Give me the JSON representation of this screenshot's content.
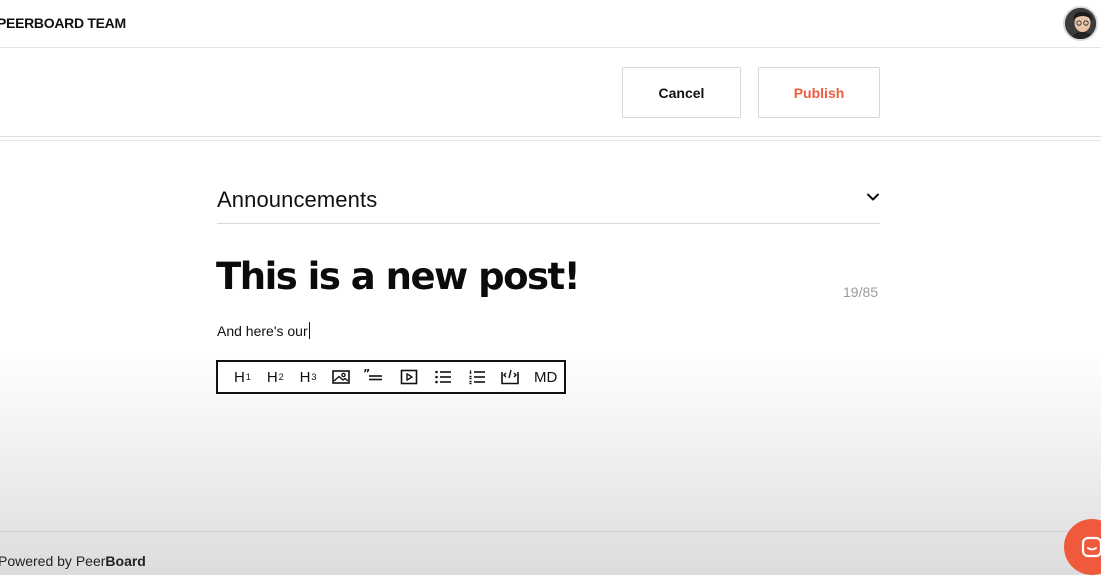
{
  "header": {
    "brand": "PEERBOARD TEAM",
    "avatar_icon": "user-avatar"
  },
  "actions": {
    "cancel_label": "Cancel",
    "publish_label": "Publish",
    "publish_color": "#f05a3c"
  },
  "editor": {
    "category": "Announcements",
    "category_icon": "chevron-down-icon",
    "title": "This is a new post!",
    "title_counter": "19/85",
    "body_text": "And here's our"
  },
  "toolbar": {
    "h1": "H",
    "h1_sub": "1",
    "h2": "H",
    "h2_sub": "2",
    "h3": "H",
    "h3_sub": "3",
    "image_icon": "image-icon",
    "quote_icon": "quote-icon",
    "video_icon": "video-icon",
    "bullet_list_icon": "bullet-list-icon",
    "numbered_list_icon": "numbered-list-icon",
    "code_icon": "code-icon",
    "md": "MD"
  },
  "footer": {
    "powered_prefix": "Powered by Peer",
    "powered_brand": "Board"
  },
  "chat": {
    "icon": "chat-icon",
    "color": "#f05a3c"
  }
}
